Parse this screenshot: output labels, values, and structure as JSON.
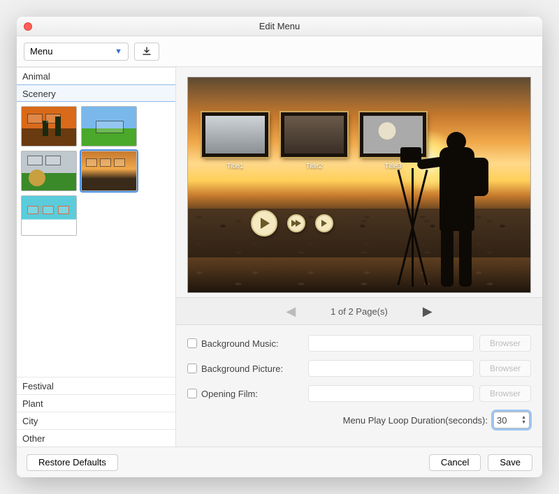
{
  "window": {
    "title": "Edit Menu"
  },
  "toolbar": {
    "dropdown_label": "Menu",
    "download_icon": "download-icon"
  },
  "categories_top": [
    "Animal",
    "Scenery"
  ],
  "categories_bottom": [
    "Festival",
    "Plant",
    "City",
    "Other"
  ],
  "selected_category": "Scenery",
  "preview": {
    "titles": [
      "Title1",
      "Title2",
      "Title3"
    ]
  },
  "pager": {
    "text": "1 of 2 Page(s)",
    "prev_enabled": false,
    "next_enabled": true
  },
  "form": {
    "bg_music": {
      "label": "Background Music:",
      "value": "",
      "browse": "Browser"
    },
    "bg_picture": {
      "label": "Background Picture:",
      "value": "",
      "browse": "Browser"
    },
    "opening_film": {
      "label": "Opening Film:",
      "value": "",
      "browse": "Browser"
    },
    "loop_label": "Menu Play Loop Duration(seconds):",
    "loop_value": "30"
  },
  "footer": {
    "restore": "Restore Defaults",
    "cancel": "Cancel",
    "save": "Save"
  }
}
